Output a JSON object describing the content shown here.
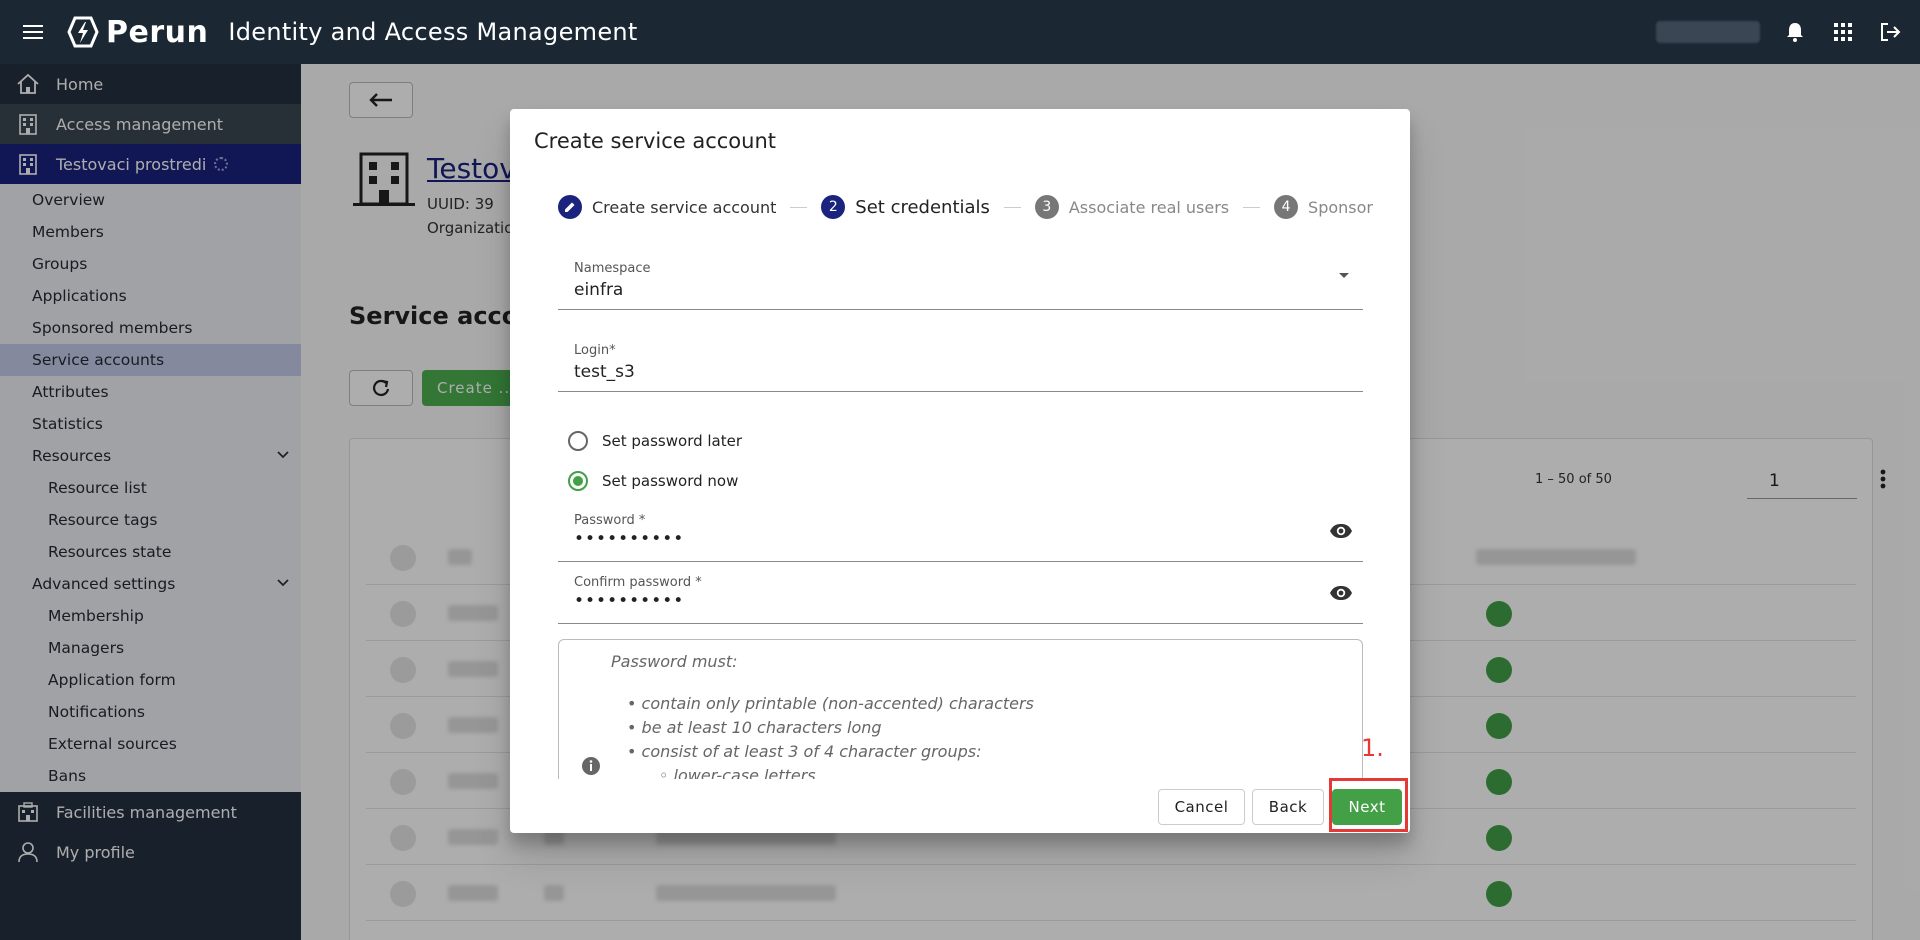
{
  "topbar": {
    "brand": "Perun",
    "app_title": "Identity and Access Management"
  },
  "sidebar": {
    "home": "Home",
    "access": "Access management",
    "vo": "Testovaci prostredi",
    "children": [
      "Overview",
      "Members",
      "Groups",
      "Applications",
      "Sponsored members",
      "Service accounts",
      "Attributes",
      "Statistics",
      "Resources"
    ],
    "resources_children": [
      "Resource list",
      "Resource tags",
      "Resources state"
    ],
    "advanced": "Advanced settings",
    "advanced_children": [
      "Membership",
      "Managers",
      "Application form",
      "Notifications",
      "External sources",
      "Bans"
    ],
    "facilities": "Facilities management",
    "profile": "My profile"
  },
  "page": {
    "vo_name": "Testov",
    "uuid_label": "UUID: 39",
    "org_label": "Organizatio",
    "section_title": "Service accoun",
    "create_label": "Create ...",
    "pager_range": "1 – 50 of 50",
    "page_number": "1"
  },
  "dialog": {
    "title": "Create service account",
    "steps": [
      {
        "num": "✎",
        "label": "Create service account",
        "state": "done"
      },
      {
        "num": "2",
        "label": "Set credentials",
        "state": "current"
      },
      {
        "num": "3",
        "label": "Associate real users",
        "state": "future"
      },
      {
        "num": "4",
        "label": "Sponsor",
        "state": "future"
      }
    ],
    "namespace": {
      "label": "Namespace",
      "value": "einfra"
    },
    "login": {
      "label": "Login*",
      "value": "test_s3"
    },
    "radio_later": "Set password later",
    "radio_now": "Set password now",
    "password": {
      "label": "Password *",
      "value": "••••••••••"
    },
    "confirm": {
      "label": "Confirm password *",
      "value": "••••••••••"
    },
    "hint_title": "Password must:",
    "hint_items": [
      "contain only printable (non-accented) characters",
      "be at least 10 characters long",
      "consist of at least 3 of 4 character groups:",
      "lower-case letters"
    ],
    "cancel": "Cancel",
    "back": "Back",
    "next": "Next"
  },
  "annotation": {
    "label": "1."
  },
  "colors": {
    "accent": "#1a237e",
    "success": "#43a047",
    "highlight": "#e53935",
    "topbar": "#1b2733"
  }
}
